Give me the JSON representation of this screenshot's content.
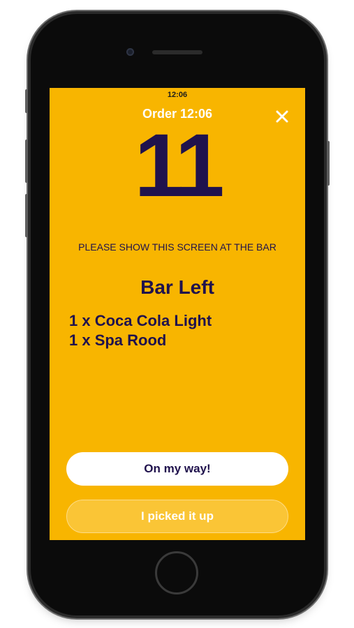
{
  "status_bar": {
    "time": "12:06"
  },
  "header": {
    "title": "Order 12:06",
    "close_icon": "close-icon"
  },
  "order": {
    "number": "11",
    "instruction": "PLEASE SHOW THIS SCREEN AT THE BAR",
    "location": "Bar Left",
    "items": [
      "1 x Coca Cola Light",
      "1 x Spa Rood"
    ]
  },
  "actions": {
    "on_my_way_label": "On my way!",
    "picked_up_label": "I picked it up"
  },
  "colors": {
    "background": "#f8b500",
    "accent_text": "#20124d",
    "primary_button": "#ffffff",
    "secondary_button": "#fac536"
  }
}
